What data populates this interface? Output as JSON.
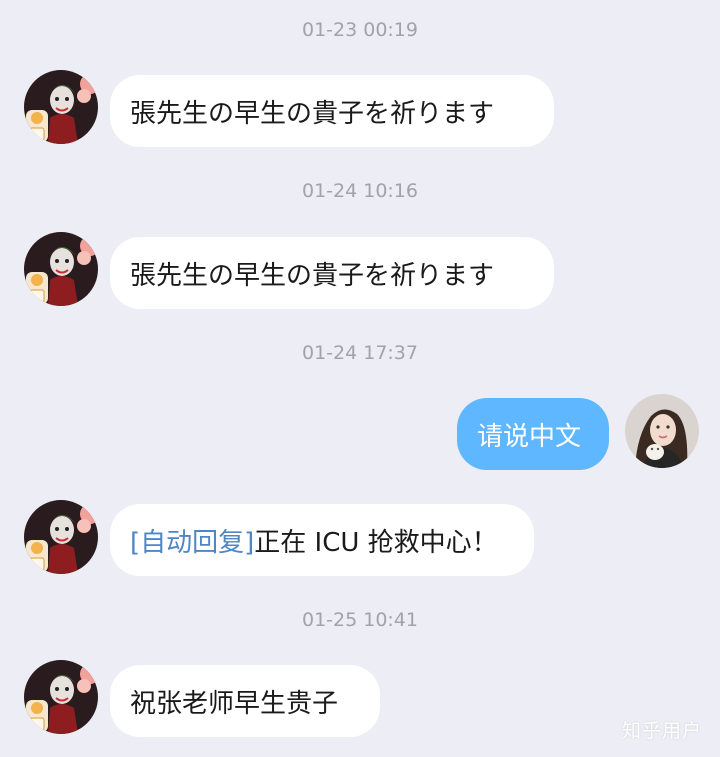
{
  "colors": {
    "background": "#ededf5",
    "incoming_bubble": "#ffffff",
    "outgoing_bubble": "#5eb7ff",
    "timestamp_text": "#a2a2a8",
    "auto_reply_tag": "#4f86c6"
  },
  "messages": [
    {
      "timestamp": "01-23 00:19",
      "sender": "contact",
      "text": "張先生の早生の貴子を祈ります"
    },
    {
      "timestamp": "01-24 10:16",
      "sender": "contact",
      "text": "張先生の早生の貴子を祈ります"
    },
    {
      "timestamp": "01-24 17:37",
      "sender": "me",
      "text": "请说中文"
    },
    {
      "timestamp": "",
      "sender": "contact",
      "tag": "[自动回复]",
      "text": "正在 ICU 抢救中心！"
    },
    {
      "timestamp": "01-25 10:41",
      "sender": "contact",
      "text": "祝张老师早生贵子"
    }
  ],
  "watermark": "知乎用户"
}
